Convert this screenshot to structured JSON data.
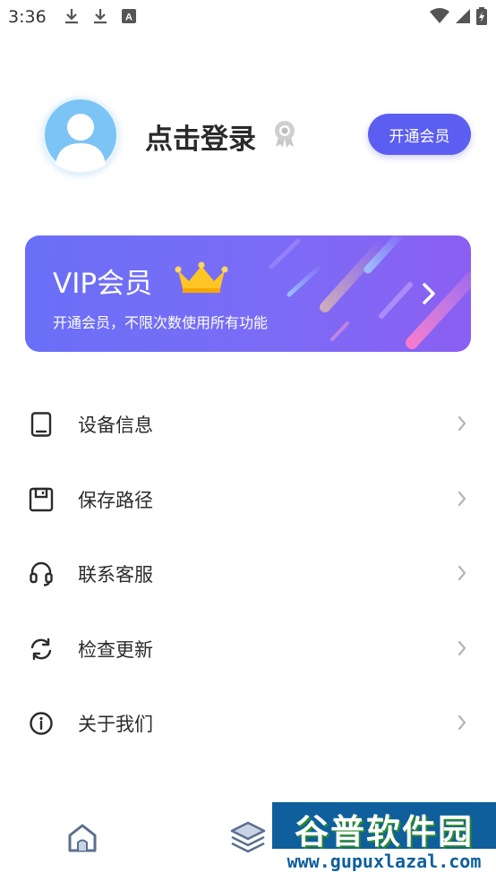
{
  "status_bar": {
    "time": "3:36",
    "icons": [
      "download-icon",
      "download-icon",
      "a-letter-icon"
    ],
    "right_icons": [
      "wifi-icon",
      "cell-signal-icon",
      "battery-icon"
    ]
  },
  "profile": {
    "login_text": "点击登录",
    "badge_icon": "award-ribbon-icon",
    "vip_button": "开通会员"
  },
  "vip_card": {
    "title": "VIP会员",
    "subtitle": "开通会员，不限次数使用所有功能",
    "crown_icon": "crown-icon",
    "arrow_icon": "chevron-right-icon"
  },
  "menu": [
    {
      "label": "设备信息",
      "icon": "device-phone-icon"
    },
    {
      "label": "保存路径",
      "icon": "save-disk-icon"
    },
    {
      "label": "联系客服",
      "icon": "headset-icon"
    },
    {
      "label": "检查更新",
      "icon": "refresh-icon"
    },
    {
      "label": "关于我们",
      "icon": "info-icon"
    }
  ],
  "bottom_nav": [
    "home-icon",
    "layers-icon"
  ],
  "watermark": {
    "title": "谷普软件园",
    "url": "www.gupuxlazal.com"
  },
  "colors": {
    "accent": "#5b5ef0",
    "vip_gradient_start": "#6a6ff7",
    "vip_gradient_end": "#8b5ff2"
  }
}
